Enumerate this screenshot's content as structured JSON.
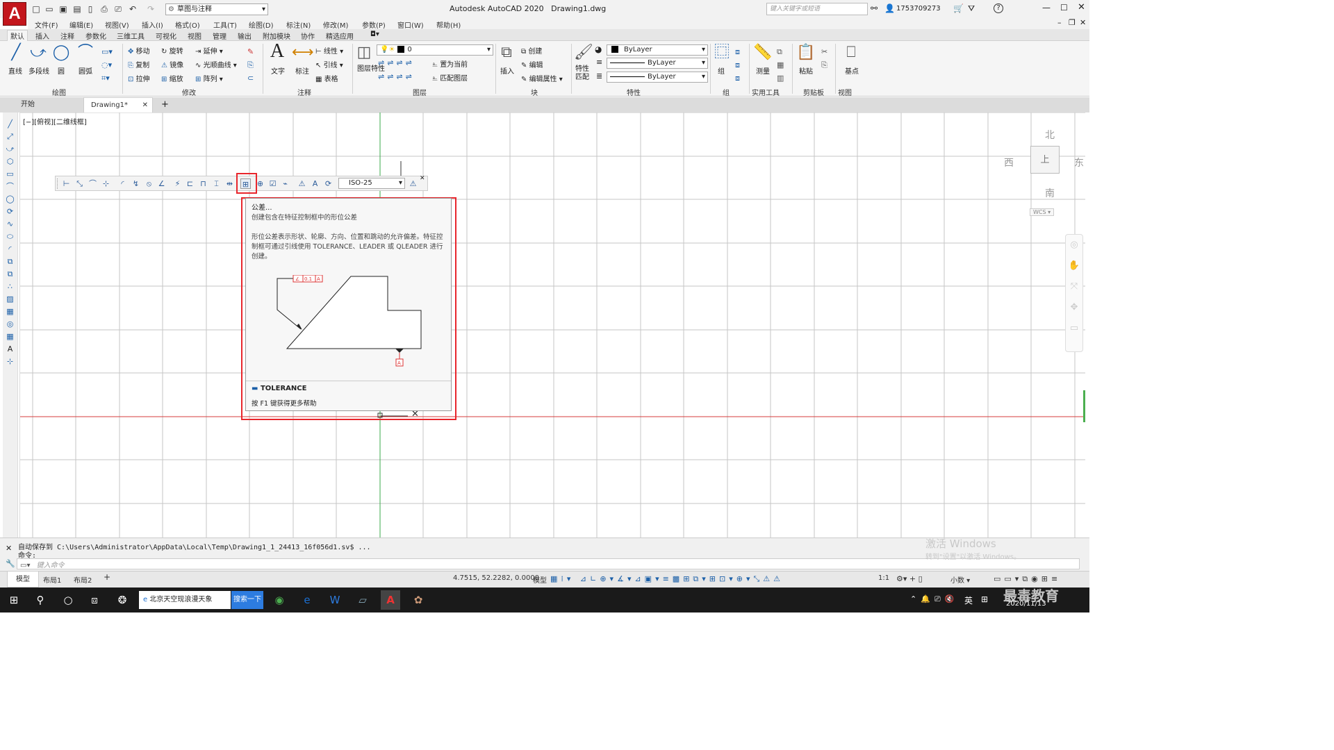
{
  "app": {
    "logo": "A",
    "title": "Autodesk AutoCAD 2020",
    "drawing": "Drawing1.dwg",
    "workspace": "草图与注释",
    "search_placeholder": "键入关键字或短语",
    "user": "1753709273",
    "help": "?",
    "accent": "#c3161c"
  },
  "menus": [
    "文件(F)",
    "编辑(E)",
    "视图(V)",
    "插入(I)",
    "格式(O)",
    "工具(T)",
    "绘图(D)",
    "标注(N)",
    "修改(M)",
    "参数(P)",
    "窗口(W)",
    "帮助(H)"
  ],
  "ribbon_tabs": [
    "默认",
    "插入",
    "注释",
    "参数化",
    "三维工具",
    "可视化",
    "视图",
    "管理",
    "输出",
    "附加模块",
    "协作",
    "精选应用"
  ],
  "ribbon": {
    "draw": {
      "label": "绘图",
      "tools": [
        "直线",
        "多段线",
        "圆",
        "圆弧"
      ]
    },
    "modify": {
      "label": "修改",
      "tools": [
        "移动",
        "旋转",
        "延伸",
        "复制",
        "镜像",
        "光顺曲线",
        "拉伸",
        "缩放",
        "阵列"
      ]
    },
    "annotation": {
      "label": "注释",
      "tools": [
        "文字",
        "标注",
        "线性",
        "引线",
        "表格"
      ]
    },
    "layers": {
      "label": "图层",
      "tools": [
        "图层特性",
        "置为当前",
        "匹配图层"
      ],
      "current": "0"
    },
    "block": {
      "label": "块",
      "tools": [
        "插入",
        "创建",
        "编辑",
        "编辑属性"
      ]
    },
    "properties": {
      "label": "特性",
      "tools": [
        "特性匹配"
      ],
      "color": "ByLayer",
      "linetype": "ByLayer",
      "lineweight": "ByLayer"
    },
    "groups": {
      "label": "组",
      "tools": [
        "组"
      ]
    },
    "utilities": {
      "label": "实用工具",
      "tools": [
        "测量"
      ]
    },
    "clipboard": {
      "label": "剪贴板",
      "tools": [
        "粘贴"
      ]
    },
    "view": {
      "label": "视图",
      "tools": [
        "基点"
      ]
    }
  },
  "doc_tabs": [
    "开始",
    "Drawing1*"
  ],
  "viewport_label": "[−][俯视][二维线框]",
  "dim_style": "ISO-25",
  "tooltip": {
    "title": "公差...",
    "desc": "创建包含在特征控制框中的形位公差",
    "detail": "形位公差表示形状、轮廓、方向、位置和跳动的允许偏差。特征控制框可通过引线使用 TOLERANCE、LEADER 或 QLEADER 进行创建。",
    "frame_value": "0.1",
    "datum": "A",
    "command": "TOLERANCE",
    "help": "按 F1 键获得更多帮助"
  },
  "viewcube": {
    "north": "北",
    "south": "南",
    "east": "东",
    "west": "西",
    "top": "上",
    "wcs": "WCS"
  },
  "command": {
    "history": "自动保存到 C:\\Users\\Administrator\\AppData\\Local\\Temp\\Drawing1_1_24413_16f056d1.sv$ ...",
    "prompt": "命令:",
    "placeholder": "键入命令"
  },
  "layout_tabs": [
    "模型",
    "布局1",
    "布局2"
  ],
  "status": {
    "coords": "4.7515, 52.2282, 0.0000",
    "space": "模型",
    "scale": "1:1",
    "units": "小数"
  },
  "watermark": {
    "line1": "激活 Windows",
    "line2": "转到\"设置\"以激活 Windows。"
  },
  "taskbar": {
    "browser_tab": "北京天空现浪漫天象",
    "search_btn": "搜索一下",
    "time": "",
    "date": "2020/11/13",
    "lang": "英",
    "brand": "最毒教育"
  }
}
